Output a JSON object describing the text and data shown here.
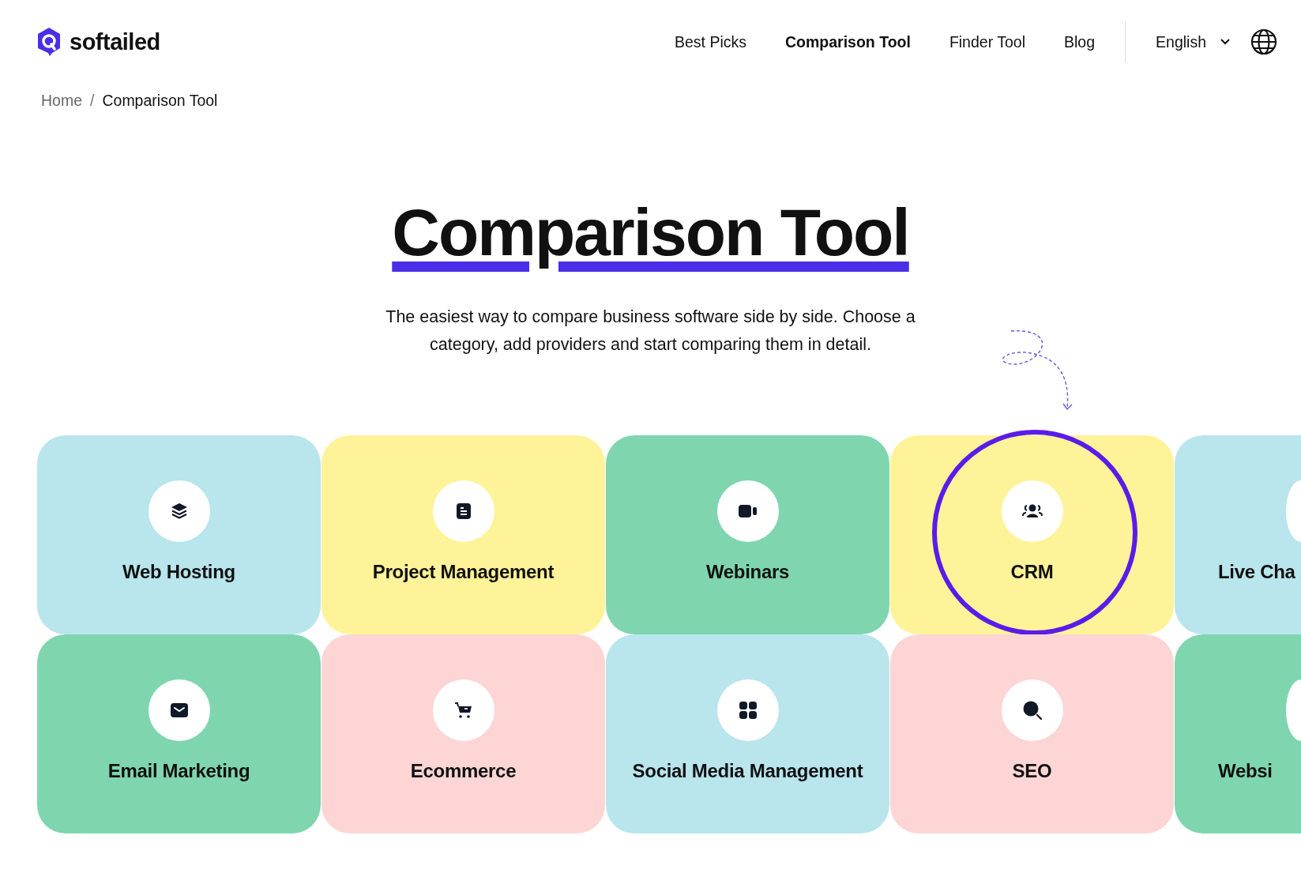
{
  "logo": {
    "text": "softailed"
  },
  "nav": {
    "items": [
      {
        "label": "Best Picks",
        "selected": false
      },
      {
        "label": "Comparison Tool",
        "selected": true
      },
      {
        "label": "Finder Tool",
        "selected": false
      },
      {
        "label": "Blog",
        "selected": false
      }
    ],
    "language": "English"
  },
  "breadcrumb_separator": "/",
  "breadcrumb": [
    {
      "label": "Home",
      "current": false
    },
    {
      "label": "Comparison Tool",
      "current": true
    }
  ],
  "hero": {
    "title": "Comparison Tool",
    "description": "The easiest way to compare business software side by side. Choose a category, add providers and start comparing them in detail."
  },
  "category_rows": [
    {
      "cards": [
        {
          "label": "Web Hosting",
          "color": "#b9e5ed",
          "kind": "full",
          "highlighted": false
        },
        {
          "label": "Project Management",
          "color": "#fef398",
          "kind": "full",
          "highlighted": false
        },
        {
          "label": "Webinars",
          "color": "#7fd6ae",
          "kind": "full",
          "highlighted": false
        },
        {
          "label": "CRM",
          "color": "#fef398",
          "kind": "full",
          "highlighted": true
        },
        {
          "label": "Live Cha",
          "color": "#b9e5ed",
          "kind": "partial",
          "highlighted": false
        }
      ]
    },
    {
      "cards": [
        {
          "label": "Email Marketing",
          "color": "#7fd6ae",
          "kind": "full",
          "highlighted": false
        },
        {
          "label": "Ecommerce",
          "color": "#fdd5d5",
          "kind": "full",
          "highlighted": false
        },
        {
          "label": "Social Media Management",
          "color": "#b9e5ed",
          "kind": "full",
          "highlighted": false
        },
        {
          "label": "SEO",
          "color": "#fdd5d5",
          "kind": "full",
          "highlighted": false
        },
        {
          "label": "Websi",
          "color": "#7fd6ae",
          "kind": "partial",
          "highlighted": false
        }
      ]
    }
  ]
}
